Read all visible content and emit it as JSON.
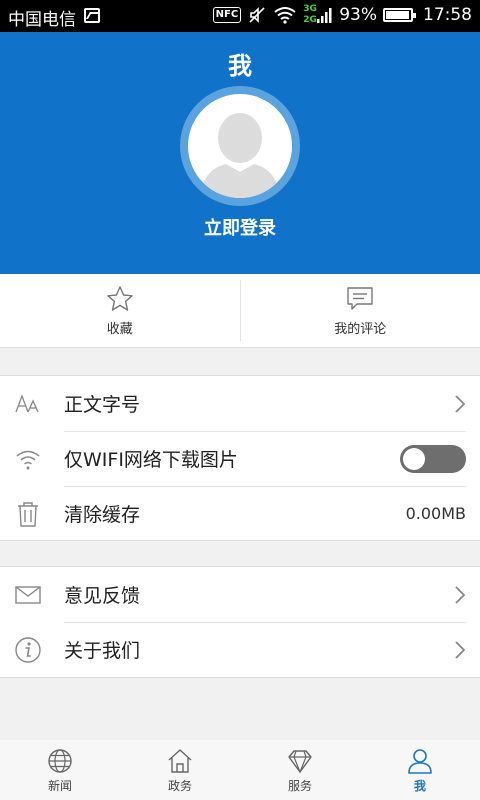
{
  "status_bar": {
    "carrier": "中国电信",
    "nfc": "NFC",
    "net_3g": "3G",
    "net_2g": "2G",
    "battery": "93%",
    "time": "17:58"
  },
  "header": {
    "title": "我",
    "login": "立即登录",
    "color": "#1072c9"
  },
  "quick_actions": [
    {
      "label": "收藏",
      "icon": "star-icon"
    },
    {
      "label": "我的评论",
      "icon": "comment-icon"
    }
  ],
  "settings_group_1": [
    {
      "label": "正文字号",
      "icon": "font-size-icon",
      "control": "chevron"
    },
    {
      "label": "仅WIFI网络下载图片",
      "icon": "wifi-icon",
      "control": "toggle",
      "enabled": false
    },
    {
      "label": "清除缓存",
      "icon": "trash-icon",
      "control": "value",
      "value": "0.00MB"
    }
  ],
  "settings_group_2": [
    {
      "label": "意见反馈",
      "icon": "mail-icon",
      "control": "chevron"
    },
    {
      "label": "关于我们",
      "icon": "info-icon",
      "control": "chevron"
    }
  ],
  "bottom_nav": {
    "items": [
      {
        "label": "新闻",
        "icon": "globe-icon",
        "active": false
      },
      {
        "label": "政务",
        "icon": "house-icon",
        "active": false
      },
      {
        "label": "服务",
        "icon": "diamond-icon",
        "active": false
      },
      {
        "label": "我",
        "icon": "user-icon",
        "active": true
      }
    ],
    "active_color": "#1a78c8"
  }
}
